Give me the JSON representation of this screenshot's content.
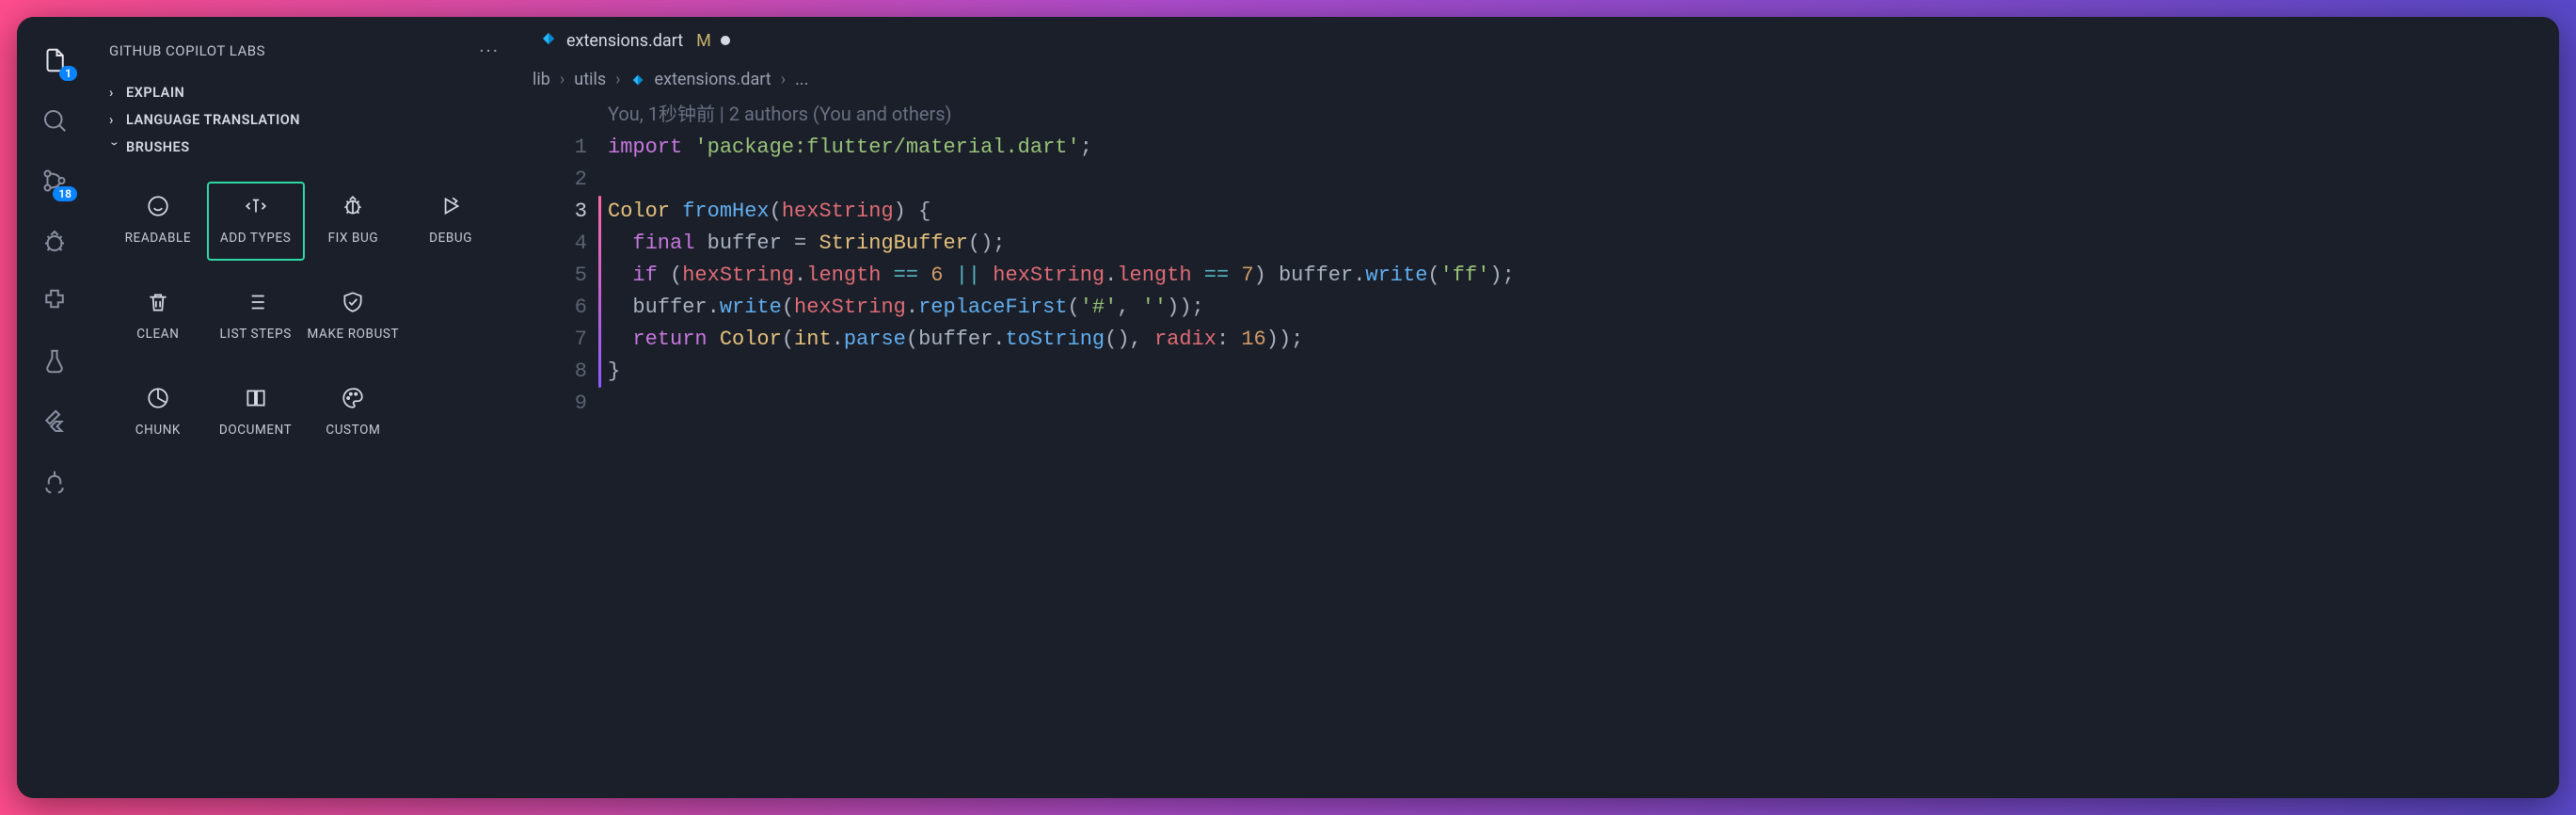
{
  "activity": {
    "items": [
      {
        "name": "explorer",
        "badge": "1",
        "active": true
      },
      {
        "name": "search",
        "badge": null,
        "active": false
      },
      {
        "name": "source-control",
        "badge": "18",
        "active": false
      },
      {
        "name": "debug",
        "badge": null,
        "active": false
      },
      {
        "name": "extensions",
        "badge": null,
        "active": false
      },
      {
        "name": "flask",
        "badge": null,
        "active": false
      },
      {
        "name": "flutter",
        "badge": null,
        "active": false
      },
      {
        "name": "tree",
        "badge": null,
        "active": false
      }
    ]
  },
  "panel": {
    "title": "GITHUB COPILOT LABS",
    "sections": [
      {
        "label": "EXPLAIN",
        "expanded": false
      },
      {
        "label": "LANGUAGE TRANSLATION",
        "expanded": false
      },
      {
        "label": "BRUSHES",
        "expanded": true
      }
    ],
    "brushes": [
      {
        "label": "READABLE",
        "icon": "smile",
        "selected": false
      },
      {
        "label": "ADD TYPES",
        "icon": "types",
        "selected": true
      },
      {
        "label": "FIX BUG",
        "icon": "bug",
        "selected": false
      },
      {
        "label": "DEBUG",
        "icon": "play",
        "selected": false
      },
      {
        "label": "CLEAN",
        "icon": "trash",
        "selected": false
      },
      {
        "label": "LIST STEPS",
        "icon": "list",
        "selected": false
      },
      {
        "label": "MAKE ROBUST",
        "icon": "shield",
        "selected": false
      },
      {
        "label": "CHUNK",
        "icon": "pie",
        "selected": false
      },
      {
        "label": "DOCUMENT",
        "icon": "book",
        "selected": false
      },
      {
        "label": "CUSTOM",
        "icon": "palette",
        "selected": false
      }
    ]
  },
  "editor": {
    "tab": {
      "filename": "extensions.dart",
      "modified_marker": "M"
    },
    "breadcrumbs": [
      "lib",
      "utils",
      "extensions.dart",
      "..."
    ],
    "blame": "You, 1秒钟前 | 2 authors (You and others)",
    "line_numbers": [
      "1",
      "2",
      "3",
      "4",
      "5",
      "6",
      "7",
      "8",
      "9"
    ],
    "current_line_index": 2,
    "tokens": {
      "l1": {
        "import": "import",
        "pkg": "'package:flutter/material.dart'"
      },
      "l3": {
        "Color": "Color",
        "fromHex": "fromHex",
        "hexString": "hexString"
      },
      "l4": {
        "final": "final",
        "buffer": "buffer",
        "StringBuffer": "StringBuffer"
      },
      "l5": {
        "if": "if",
        "hexString": "hexString",
        "length": "length",
        "six": "6",
        "seven": "7",
        "buffer": "buffer",
        "write": "write",
        "ff": "'ff'"
      },
      "l6": {
        "buffer": "buffer",
        "write": "write",
        "hexString": "hexString",
        "replaceFirst": "replaceFirst",
        "hash": "'#'",
        "empty": "''"
      },
      "l7": {
        "return": "return",
        "Color": "Color",
        "int": "int",
        "parse": "parse",
        "buffer": "buffer",
        "toString": "toString",
        "radix": "radix",
        "sixteen": "16"
      }
    }
  }
}
